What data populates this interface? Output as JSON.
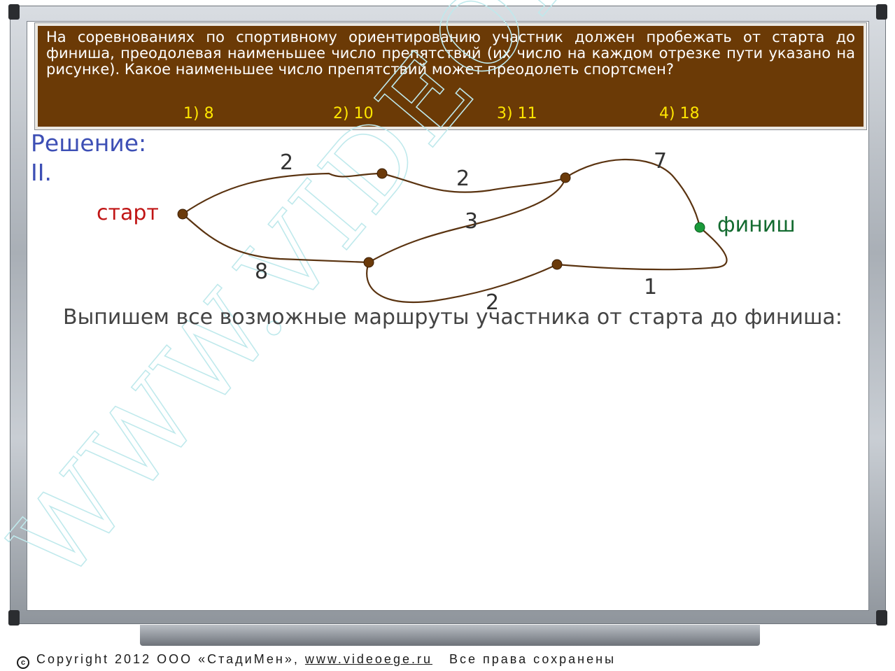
{
  "question": {
    "text": "На соревнованиях по спортивному ориентированию участник должен пробежать от старта до финиша, преодолевая наименьшее число препятствий (их число на каждом отрезке пути указано на рисунке). Какое наименьшее число препятствий может преодолеть спортсмен?",
    "options": [
      "1) 8",
      "2) 10",
      "3) 11",
      "4) 18"
    ]
  },
  "solution": {
    "title": "Решение:",
    "part": "II."
  },
  "graph": {
    "start_label": "старт",
    "finish_label": "финиш",
    "edge_weights": {
      "start_top": "2",
      "top_right": "2",
      "right_finish": "7",
      "middle_right": "3",
      "start_middle": "8",
      "middle_bottom": "2",
      "bottom_finish": "1"
    },
    "colors": {
      "edge": "#5a3310",
      "node": "#6b3a0a",
      "finish_node": "#1a9a3a",
      "start_text": "#c01515",
      "finish_text": "#136b30"
    }
  },
  "routes_intro": "Выпишем все возможные маршруты участника от старта до финиша:",
  "watermark": "WWW.VIDEOEGE.RU",
  "footer": {
    "copyright": "Copyright 2012 ООО «СтадиМен»,",
    "site": "www.videoege.ru",
    "rights": "Все права сохранены"
  }
}
